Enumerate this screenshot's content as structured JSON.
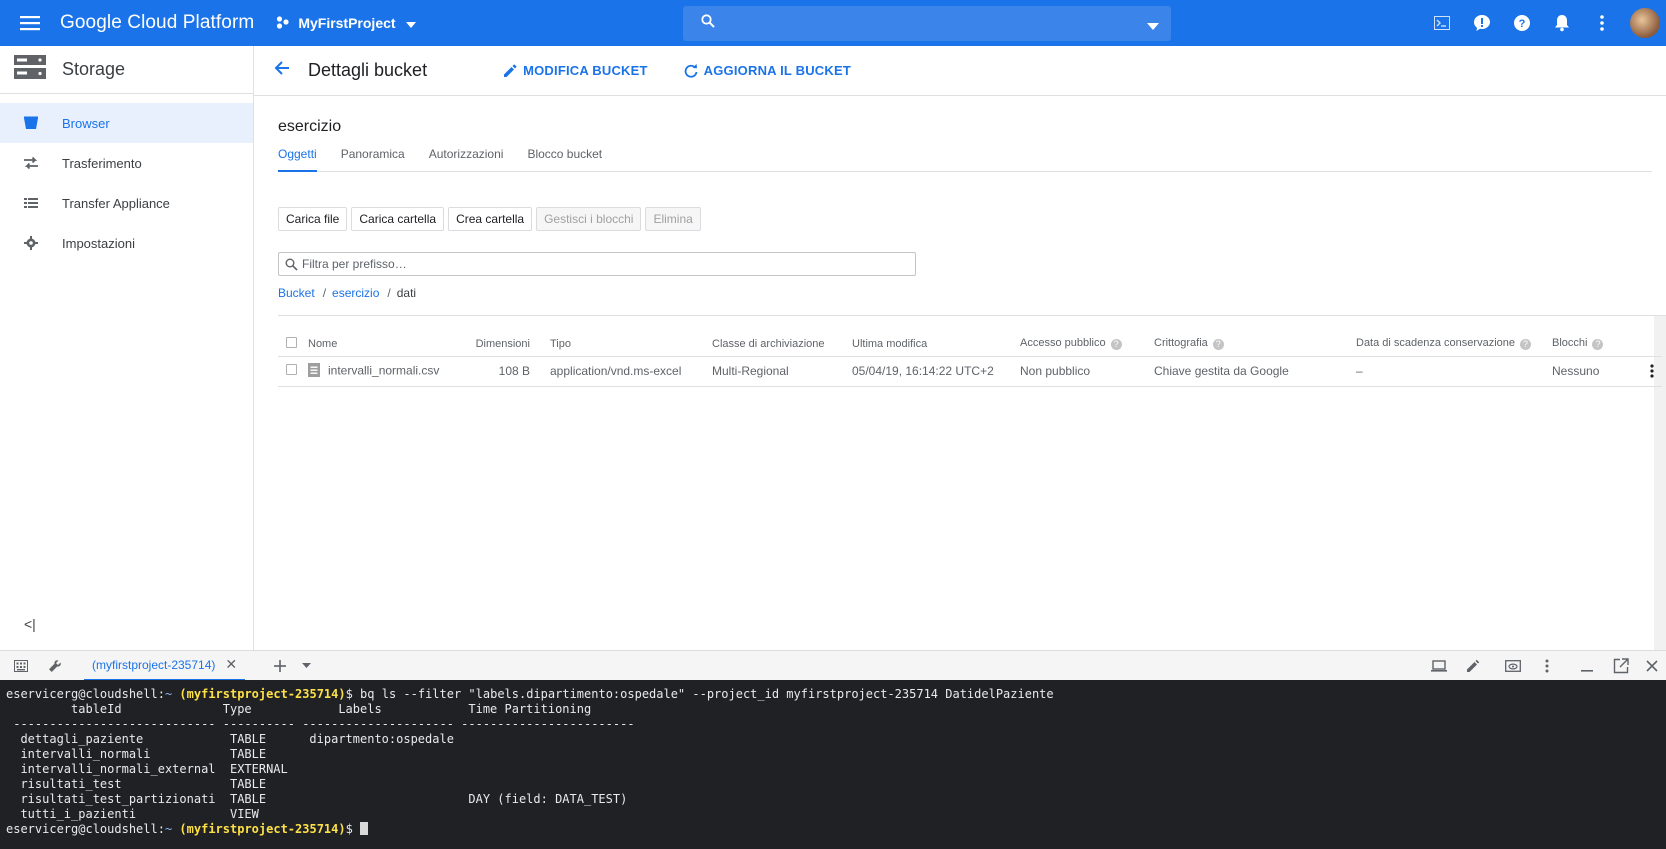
{
  "topbar": {
    "brand": "Google Cloud Platform",
    "project": "MyFirstProject",
    "search_placeholder": ""
  },
  "sidebar": {
    "title": "Storage",
    "items": [
      {
        "label": "Browser",
        "icon": "bucket-icon",
        "active": true
      },
      {
        "label": "Trasferimento",
        "icon": "transfer-icon"
      },
      {
        "label": "Transfer Appliance",
        "icon": "appliance-icon"
      },
      {
        "label": "Impostazioni",
        "icon": "gear-icon"
      }
    ],
    "collapse": "<|"
  },
  "header": {
    "title": "Dettagli bucket",
    "edit_label": "MODIFICA BUCKET",
    "refresh_label": "AGGIORNA IL BUCKET"
  },
  "bucket": {
    "name": "esercizio",
    "tabs": [
      "Oggetti",
      "Panoramica",
      "Autorizzazioni",
      "Blocco bucket"
    ]
  },
  "actions": {
    "upload_files": "Carica file",
    "upload_folder": "Carica cartella",
    "create_folder": "Crea cartella",
    "manage_holds": "Gestisci i blocchi",
    "delete": "Elimina"
  },
  "filter": {
    "placeholder": "Filtra per prefisso…"
  },
  "breadcrumb": {
    "root": "Bucket",
    "bucket": "esercizio",
    "folder": "dati",
    "sep": "/"
  },
  "table": {
    "headers": {
      "name": "Nome",
      "size": "Dimensioni",
      "type": "Tipo",
      "storage_class": "Classe di archiviazione",
      "last_modified": "Ultima modifica",
      "public_access": "Accesso pubblico",
      "encryption": "Crittografia",
      "retention": "Data di scadenza conservazione",
      "holds": "Blocchi"
    },
    "rows": [
      {
        "name": "intervalli_normali.csv",
        "size": "108 B",
        "type": "application/vnd.ms-excel",
        "storage_class": "Multi-Regional",
        "last_modified": "05/04/19, 16:14:22 UTC+2",
        "public_access": "Non pubblico",
        "encryption": "Chiave gestita da Google",
        "retention": "–",
        "holds": "Nessuno"
      }
    ]
  },
  "shell": {
    "tab_label": "(myfirstproject-235714)",
    "prompt_user": "eservicerg@cloudshell:",
    "prompt_path": "~",
    "prompt_project": "(myfirstproject-235714)",
    "prompt_end": "$",
    "command": " bq ls --filter \"labels.dipartimento:ospedale\" --project_id myfirstproject-235714 DatidelPaziente",
    "output": [
      "         tableId              Type            Labels            Time Partitioning",
      " ---------------------------- ---------- --------------------- ------------------------",
      "  dettagli_paziente            TABLE      dipartmento:ospedale",
      "  intervalli_normali           TABLE",
      "  intervalli_normali_external  EXTERNAL",
      "  risultati_test               TABLE",
      "  risultati_test_partizionati  TABLE                            DAY (field: DATA_TEST)",
      "  tutti_i_pazienti             VIEW"
    ]
  }
}
